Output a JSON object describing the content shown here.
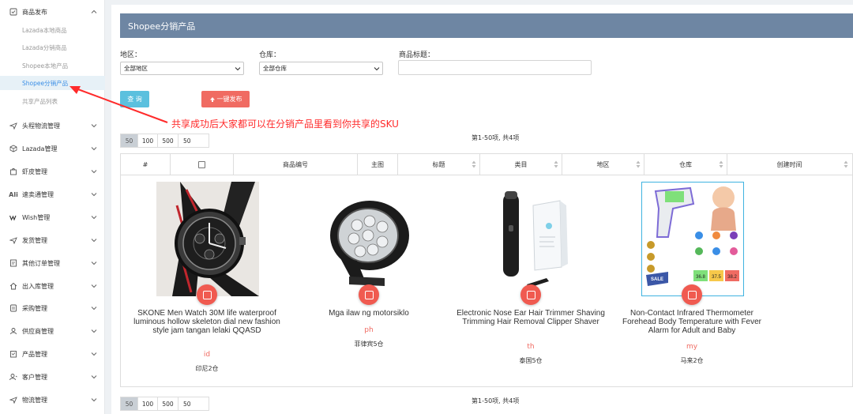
{
  "sidebar": {
    "top_group": {
      "label": "商品发布",
      "icon": "checklist-icon"
    },
    "sub_items": [
      {
        "label": "Lazada本地商品",
        "active": false
      },
      {
        "label": "Lazada分销商品",
        "active": false
      },
      {
        "label": "Shopee本地产品",
        "active": false
      },
      {
        "label": "Shopee分销产品",
        "active": true
      },
      {
        "label": "共享产品列表",
        "active": false
      }
    ],
    "groups": [
      {
        "label": "头程物流管理",
        "icon": "plane-icon"
      },
      {
        "label": "Lazada管理",
        "icon": "box-icon"
      },
      {
        "label": "虾皮管理",
        "icon": "shop-icon"
      },
      {
        "label": "速卖通管理",
        "icon": "ali-icon"
      },
      {
        "label": "Wish管理",
        "icon": "wish-icon"
      },
      {
        "label": "发货管理",
        "icon": "plane-icon"
      },
      {
        "label": "其他订单管理",
        "icon": "document-icon"
      },
      {
        "label": "出入库管理",
        "icon": "home-icon"
      },
      {
        "label": "采购管理",
        "icon": "cart-icon"
      },
      {
        "label": "供应商管理",
        "icon": "supplier-icon"
      },
      {
        "label": "产品管理",
        "icon": "clipboard-icon"
      },
      {
        "label": "客户管理",
        "icon": "user-icon"
      },
      {
        "label": "物流管理",
        "icon": "plane-icon"
      }
    ]
  },
  "page": {
    "title": "Shopee分销产品"
  },
  "filters": {
    "region_label": "地区：",
    "region_value": "全部地区",
    "warehouse_label": "仓库：",
    "warehouse_value": "全部仓库",
    "product_title_label": "商品标题：",
    "product_title_value": ""
  },
  "actions": {
    "query": "查 询",
    "publish": "一键发布"
  },
  "annotation": "共享成功后大家都可以在分销产品里看到你共享的SKU",
  "pagination": {
    "sizes": [
      "50",
      "100",
      "500"
    ],
    "active_size": "50",
    "input_value": "50",
    "info": "第1-50项, 共4项"
  },
  "table": {
    "columns": [
      "#",
      "",
      "商品编号",
      "主图",
      "标题",
      "类目",
      "地区",
      "仓库",
      "创建时间"
    ]
  },
  "products": [
    {
      "title": "SKONE Men Watch 30M life waterproof luminous hollow skeleton dial new fashion style jam tangan lelaki QQASD",
      "region": "id",
      "warehouse": "印尼2仓",
      "image": "watch-image"
    },
    {
      "title": "Mga ilaw ng motorsiklo",
      "region": "ph",
      "warehouse": "菲律宾5仓",
      "image": "motorcycle-light-image"
    },
    {
      "title": "Electronic Nose Ear Hair Trimmer Shaving Trimming Hair Removal Clipper Shaver",
      "region": "th",
      "warehouse": "泰国5仓",
      "image": "trimmer-image"
    },
    {
      "title": "Non-Contact Infrared Thermometer Forehead Body Temperature with Fever Alarm for Adult and Baby",
      "region": "my",
      "warehouse": "马来2仓",
      "image": "thermometer-image"
    }
  ],
  "thermometer_badges": {
    "readings": [
      "36.8",
      "37.5",
      "38.2"
    ],
    "sale": "SALE"
  }
}
